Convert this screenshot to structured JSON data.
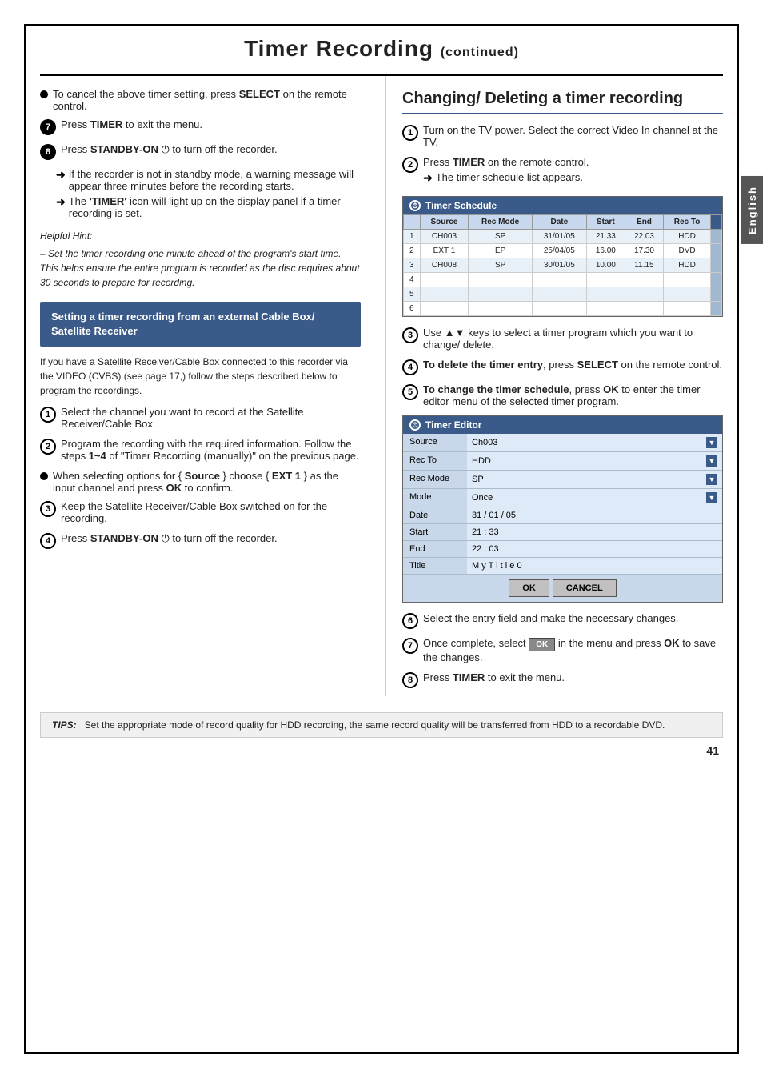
{
  "page": {
    "title": "Timer Recording",
    "continued": "(continued)",
    "page_number": "41",
    "english_tab": "English"
  },
  "left_column": {
    "bullet1": {
      "text": "To cancel the above timer setting, press ",
      "bold": "SELECT",
      "rest": " on the remote control."
    },
    "step7": {
      "prefix": "Press ",
      "bold": "TIMER",
      "rest": " to exit the menu."
    },
    "step8": {
      "prefix": "Press ",
      "bold": "STANDBY-ON",
      "rest": " to turn off the recorder."
    },
    "arrow1": "If the recorder is not in standby mode, a warning message will appear three minutes before the recording starts.",
    "arrow2_pre": "The ",
    "arrow2_bold": "'TIMER'",
    "arrow2_rest": " icon will light up on the display panel if a timer recording is set.",
    "helpful_hint_title": "Helpful Hint:",
    "helpful_hint_body": "– Set the timer recording one minute ahead of the program's start time. This helps ensure the entire program is recorded as the disc requires about 30 seconds to prepare for recording.",
    "blue_box_title": "Setting a timer recording from an external Cable Box/ Satellite Receiver",
    "blue_box_body": "If you have a Satellite Receiver/Cable Box connected to this recorder via the VIDEO (CVBS) (see page 17,) follow the steps described below to program the recordings.",
    "s1_pre": "Select the channel you want to record at the Satellite Receiver/Cable Box.",
    "s2_pre": "Program the recording with the required information. Follow the steps ",
    "s2_steps": "1~4",
    "s2_rest": " of \"Timer Recording (manually)\" on the previous page.",
    "s_bullet1_pre": "When selecting options for { ",
    "s_bullet1_bold": "Source",
    "s_bullet1_mid": " } choose { ",
    "s_bullet1_bold2": "EXT 1",
    "s_bullet1_rest": " } as the input channel and press ",
    "s_bullet1_ok": "OK",
    "s_bullet1_end": " to confirm.",
    "s3": "Keep the Satellite Receiver/Cable Box switched on for the recording.",
    "s4_pre": "Press ",
    "s4_bold": "STANDBY-ON",
    "s4_rest": " to turn off the recorder."
  },
  "right_column": {
    "section_title": "Changing/ Deleting a timer recording",
    "r1": "Turn on the TV power. Select the correct Video In channel at the TV.",
    "r2_pre": "Press ",
    "r2_bold": "TIMER",
    "r2_rest": " on the remote control.",
    "r2_arrow": "The timer schedule list appears.",
    "timer_schedule": {
      "title": "Timer Schedule",
      "columns": [
        "",
        "Source",
        "Rec Mode",
        "Date",
        "Start",
        "End",
        "Rec To"
      ],
      "rows": [
        {
          "num": "1",
          "source": "CH003",
          "rec_mode": "SP",
          "date": "31/01/05",
          "start": "21.33",
          "end": "22.03",
          "rec_to": "HDD"
        },
        {
          "num": "2",
          "source": "EXT 1",
          "rec_mode": "EP",
          "date": "25/04/05",
          "start": "16.00",
          "end": "17.30",
          "rec_to": "DVD"
        },
        {
          "num": "3",
          "source": "CH008",
          "rec_mode": "SP",
          "date": "30/01/05",
          "start": "10.00",
          "end": "11.15",
          "rec_to": "HDD"
        },
        {
          "num": "4",
          "source": "",
          "rec_mode": "",
          "date": "",
          "start": "",
          "end": "",
          "rec_to": ""
        },
        {
          "num": "5",
          "source": "",
          "rec_mode": "",
          "date": "",
          "start": "",
          "end": "",
          "rec_to": ""
        },
        {
          "num": "6",
          "source": "",
          "rec_mode": "",
          "date": "",
          "start": "",
          "end": "",
          "rec_to": ""
        }
      ]
    },
    "r3": "Use ▲▼ keys to select a timer program which you want to change/ delete.",
    "r4_pre": "To delete the timer entry",
    "r4_rest": ", press SELECT on the remote control.",
    "r5_pre": "To change the timer schedule",
    "r5_rest": ", press OK to enter the timer editor menu of the selected timer program.",
    "timer_editor": {
      "title": "Timer Editor",
      "rows": [
        {
          "label": "Source",
          "value": "Ch003",
          "has_dropdown": true
        },
        {
          "label": "Rec To",
          "value": "HDD",
          "has_dropdown": true
        },
        {
          "label": "Rec Mode",
          "value": "SP",
          "has_dropdown": true
        },
        {
          "label": "Mode",
          "value": "Once",
          "has_dropdown": true
        },
        {
          "label": "Date",
          "value": "31 / 01 / 05",
          "has_dropdown": false
        },
        {
          "label": "Start",
          "value": "21 : 33",
          "has_dropdown": false
        },
        {
          "label": "End",
          "value": "22 : 03",
          "has_dropdown": false
        },
        {
          "label": "Title",
          "value": "M y T i t l e 0",
          "has_dropdown": false
        }
      ],
      "ok_label": "OK",
      "cancel_label": "CANCEL"
    },
    "r6": "Select the entry field and make the necessary changes.",
    "r7_pre": "Once complete, select ",
    "r7_ok": "OK",
    "r7_rest": " in the menu and press ",
    "r7_ok2": "OK",
    "r7_end": " to save the changes.",
    "r8_pre": "Press ",
    "r8_bold": "TIMER",
    "r8_rest": " to exit the menu."
  },
  "tips": {
    "label": "TIPS:",
    "text": "Set the appropriate mode of record quality for HDD recording, the same record quality will be transferred from HDD to a recordable DVD."
  }
}
